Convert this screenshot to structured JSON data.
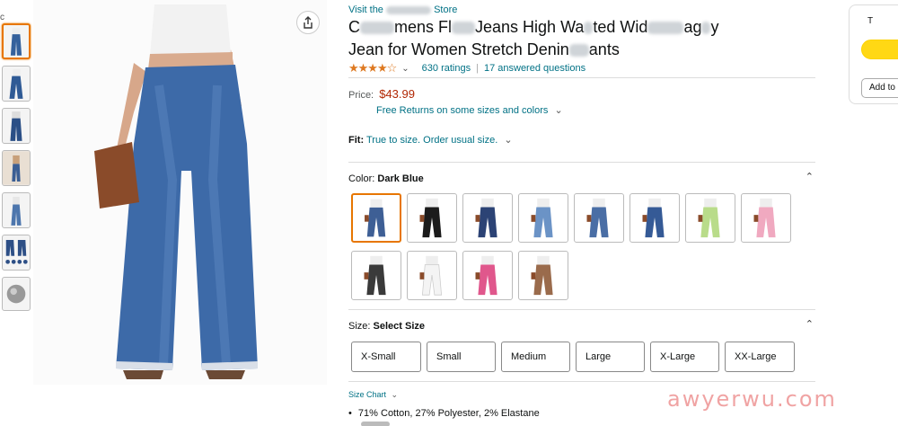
{
  "store": {
    "prefix": "Visit the",
    "suffix": "Store"
  },
  "title": {
    "line1": [
      "C",
      "mens Fl",
      "Jeans High Wa",
      "ted Wid",
      "ag",
      "y"
    ],
    "line2": [
      "Jean for Women Stretch Denin",
      "ants"
    ]
  },
  "rating": {
    "stars": "★★★★☆",
    "count_label": "630 ratings",
    "qa_label": "17 answered questions",
    "chevron": "⌄"
  },
  "price": {
    "label": "Price:",
    "value": "$43.99"
  },
  "returns": {
    "label": "Free Returns on some sizes and colors",
    "chevron": "⌄"
  },
  "fit": {
    "label": "Fit:",
    "value": "True to size. Order usual size.",
    "chevron": "⌄"
  },
  "color": {
    "label": "Color:",
    "selected": "Dark Blue",
    "chevron": "⌃",
    "swatches": [
      {
        "color": "#3e5f95",
        "selected": true
      },
      {
        "color": "#1b1b1b"
      },
      {
        "color": "#2c4375"
      },
      {
        "color": "#6b93c6"
      },
      {
        "color": "#4a6ea5"
      },
      {
        "color": "#355a96"
      },
      {
        "color": "#b9dc8a"
      },
      {
        "color": "#f0a9c0"
      },
      {
        "color": "#3a3a3a"
      },
      {
        "color": "#f4f4f4"
      },
      {
        "color": "#e0578c"
      },
      {
        "color": "#9a6b4c"
      }
    ]
  },
  "size": {
    "label": "Size:",
    "selected": "Select Size",
    "chevron": "⌃",
    "options": [
      "X-Small",
      "Small",
      "Medium",
      "Large",
      "X-Large",
      "XX-Large"
    ]
  },
  "size_chart": {
    "label": "Size Chart",
    "chevron": "⌄"
  },
  "details": {
    "bullet": "71% Cotton, 27% Polyester, 2% Elastane"
  },
  "buybox": {
    "title_letter": "T",
    "add_to_list": "Add to"
  },
  "watermark": "awyerwu.com",
  "corner_letter": "c",
  "colors": {
    "link": "#007185",
    "price": "#B12704",
    "star": "#de7921",
    "accent": "#e77600",
    "cart": "#ffd814"
  }
}
